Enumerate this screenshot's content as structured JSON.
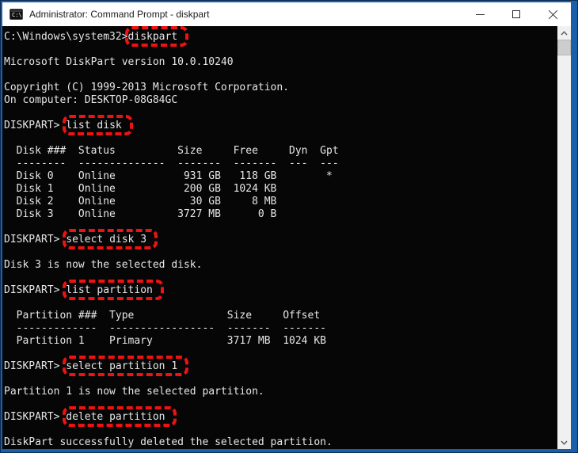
{
  "window": {
    "title": "Administrator: Command Prompt - diskpart",
    "icon_label": "C:\\",
    "controls": [
      "minimize",
      "maximize",
      "close"
    ]
  },
  "colors": {
    "window_border": "#1b5eaa",
    "window_border_outer": "#0b2c55",
    "titlebar_bg": "#ffffff",
    "titlebar_fg": "#1c1c1c",
    "terminal_bg": "#060606",
    "terminal_fg": "#e6e6e6",
    "highlight_box_red": "#ee1211",
    "scrollbar_track": "#f0f0f0",
    "scrollbar_thumb": "#cdcdcd"
  },
  "terminal": {
    "prompt": "DISKPART>",
    "lines": [
      [
        {
          "t": "C:\\Windows\\system32>"
        },
        {
          "t": "diskpart",
          "hl": true
        }
      ],
      [],
      [
        {
          "t": "Microsoft DiskPart version 10.0.10240"
        }
      ],
      [],
      [
        {
          "t": "Copyright (C) 1999-2013 Microsoft Corporation."
        }
      ],
      [
        {
          "t": "On computer: DESKTOP-08G84GC"
        }
      ],
      [],
      [
        {
          "t": "DISKPART> "
        },
        {
          "t": "list disk",
          "hl": true
        }
      ],
      [],
      [
        {
          "t": "  Disk ###  Status          Size     Free     Dyn  Gpt"
        }
      ],
      [
        {
          "t": "  --------  --------------  -------  -------  ---  ---"
        }
      ],
      [
        {
          "t": "  Disk 0    Online           931 GB   118 GB        *"
        }
      ],
      [
        {
          "t": "  Disk 1    Online           200 GB  1024 KB"
        }
      ],
      [
        {
          "t": "  Disk 2    Online            30 GB     8 MB"
        }
      ],
      [
        {
          "t": "  Disk 3    Online          3727 MB      0 B"
        }
      ],
      [],
      [
        {
          "t": "DISKPART> "
        },
        {
          "t": "select disk 3",
          "hl": true
        }
      ],
      [],
      [
        {
          "t": "Disk 3 is now the selected disk."
        }
      ],
      [],
      [
        {
          "t": "DISKPART> "
        },
        {
          "t": "list partition",
          "hl": true
        }
      ],
      [],
      [
        {
          "t": "  Partition ###  Type               Size     Offset"
        }
      ],
      [
        {
          "t": "  -------------  -----------------  -------  -------"
        }
      ],
      [
        {
          "t": "  Partition 1    Primary            3717 MB  1024 KB"
        }
      ],
      [],
      [
        {
          "t": "DISKPART> "
        },
        {
          "t": "select partition 1",
          "hl": true
        }
      ],
      [],
      [
        {
          "t": "Partition 1 is now the selected partition."
        }
      ],
      [],
      [
        {
          "t": "DISKPART> "
        },
        {
          "t": "delete partition",
          "hl": true
        }
      ],
      [],
      [
        {
          "t": "DiskPart successfully deleted the selected partition."
        }
      ]
    ]
  },
  "tables": {
    "disks": {
      "headers": [
        "Disk ###",
        "Status",
        "Size",
        "Free",
        "Dyn",
        "Gpt"
      ],
      "rows": [
        [
          "Disk 0",
          "Online",
          "931 GB",
          "118 GB",
          "",
          "*"
        ],
        [
          "Disk 1",
          "Online",
          "200 GB",
          "1024 KB",
          "",
          ""
        ],
        [
          "Disk 2",
          "Online",
          "30 GB",
          "8 MB",
          "",
          ""
        ],
        [
          "Disk 3",
          "Online",
          "3727 MB",
          "0 B",
          "",
          ""
        ]
      ]
    },
    "partitions": {
      "headers": [
        "Partition ###",
        "Type",
        "Size",
        "Offset"
      ],
      "rows": [
        [
          "Partition 1",
          "Primary",
          "3717 MB",
          "1024 KB"
        ]
      ]
    }
  }
}
